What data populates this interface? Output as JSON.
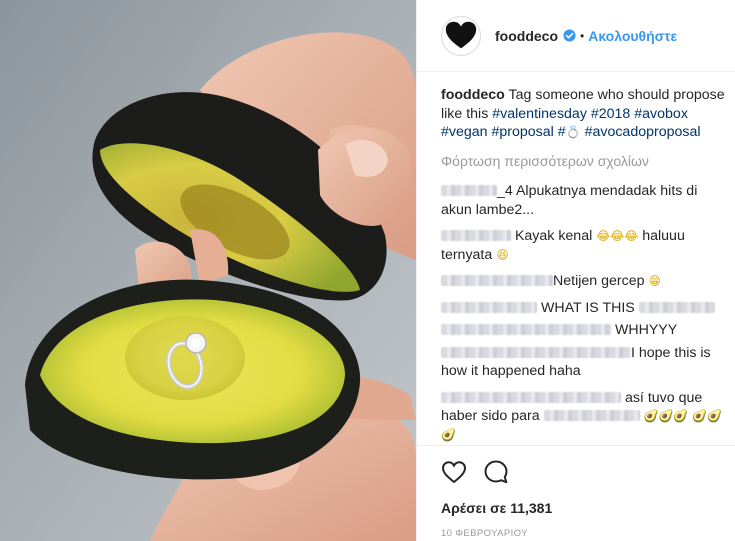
{
  "header": {
    "username": "fooddeco",
    "separator": "•",
    "follow_label": "Ακολουθήστε",
    "icons": [
      "heart-avatar-icon",
      "verified-badge-icon"
    ]
  },
  "caption": {
    "username": "fooddeco",
    "text": "Tag someone who should propose like this",
    "hashtags": [
      "#valentinesday",
      "#2018",
      "#avobox",
      "#vegan",
      "#proposal",
      "#",
      "#avocadoproposal"
    ],
    "ring_emoji": "💍"
  },
  "load_more_label": "Φόρτωση περισσότερων σχολίων",
  "comments": [
    {
      "user_suffix": "_4",
      "text": "Alpukatnya mendadak hits di akun lambe2..."
    },
    {
      "text": "Kayak kenal",
      "emoji": "😂😂😂",
      "text2": "haluuu ternyata",
      "emoji2": "😆"
    },
    {
      "text": "Netijen gercep",
      "emoji": "😁"
    },
    {
      "text": "WHAT IS THIS"
    },
    {
      "text": "WHHYYY"
    },
    {
      "text": "I hope this is how it happened haha"
    },
    {
      "text": "así tuvo que haber sido para",
      "emoji": "🥑🥑🥑",
      "emoji2": "🥑🥑🥑"
    }
  ],
  "actions": {
    "icons": [
      "like-heart-icon",
      "comment-icon"
    ],
    "likes_text": "Αρέσει σε 11,381",
    "date": "10 ΦΕΒΡΟΥΑΡΙΟΥ"
  },
  "colors": {
    "link": "#003569",
    "follow": "#3897f0",
    "muted": "#999999",
    "text": "#262626"
  }
}
